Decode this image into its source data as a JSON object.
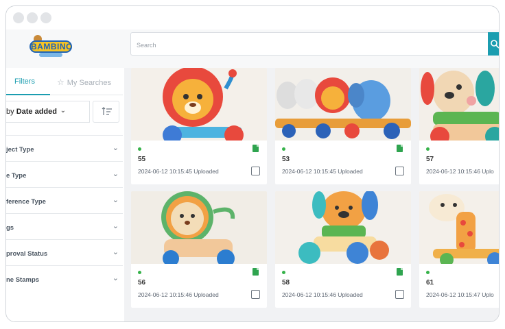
{
  "header": {
    "logo_text": "BAMBINO",
    "search_placeholder": "Search"
  },
  "sidebar": {
    "tabs": {
      "filters": "Filters",
      "my_searches": "My Searches"
    },
    "sort": {
      "prefix": "by",
      "value": "Date added"
    },
    "facets": [
      "ject Type",
      "e Type",
      "ference Type",
      "gs",
      "proval Status",
      "ne Stamps"
    ]
  },
  "cards": [
    {
      "id": "55",
      "date": "2024-06-12 10:15:45 Uploaded",
      "image": "lion-toy"
    },
    {
      "id": "53",
      "date": "2024-06-12 10:15:45 Uploaded",
      "image": "animal-parade"
    },
    {
      "id": "57",
      "date": "2024-06-12 10:15:46 Uplo",
      "image": "dog-toy"
    },
    {
      "id": "56",
      "date": "2024-06-12 10:15:46 Uploaded",
      "image": "lion-rattle"
    },
    {
      "id": "58",
      "date": "2024-06-12 10:15:46 Uploaded",
      "image": "puppy-car"
    },
    {
      "id": "61",
      "date": "2024-06-12 10:15:47 Uplo",
      "image": "giraffe-toy"
    }
  ],
  "colors": {
    "accent": "#1b9db0",
    "status": "#36b24a",
    "file": "#2fa44f"
  }
}
